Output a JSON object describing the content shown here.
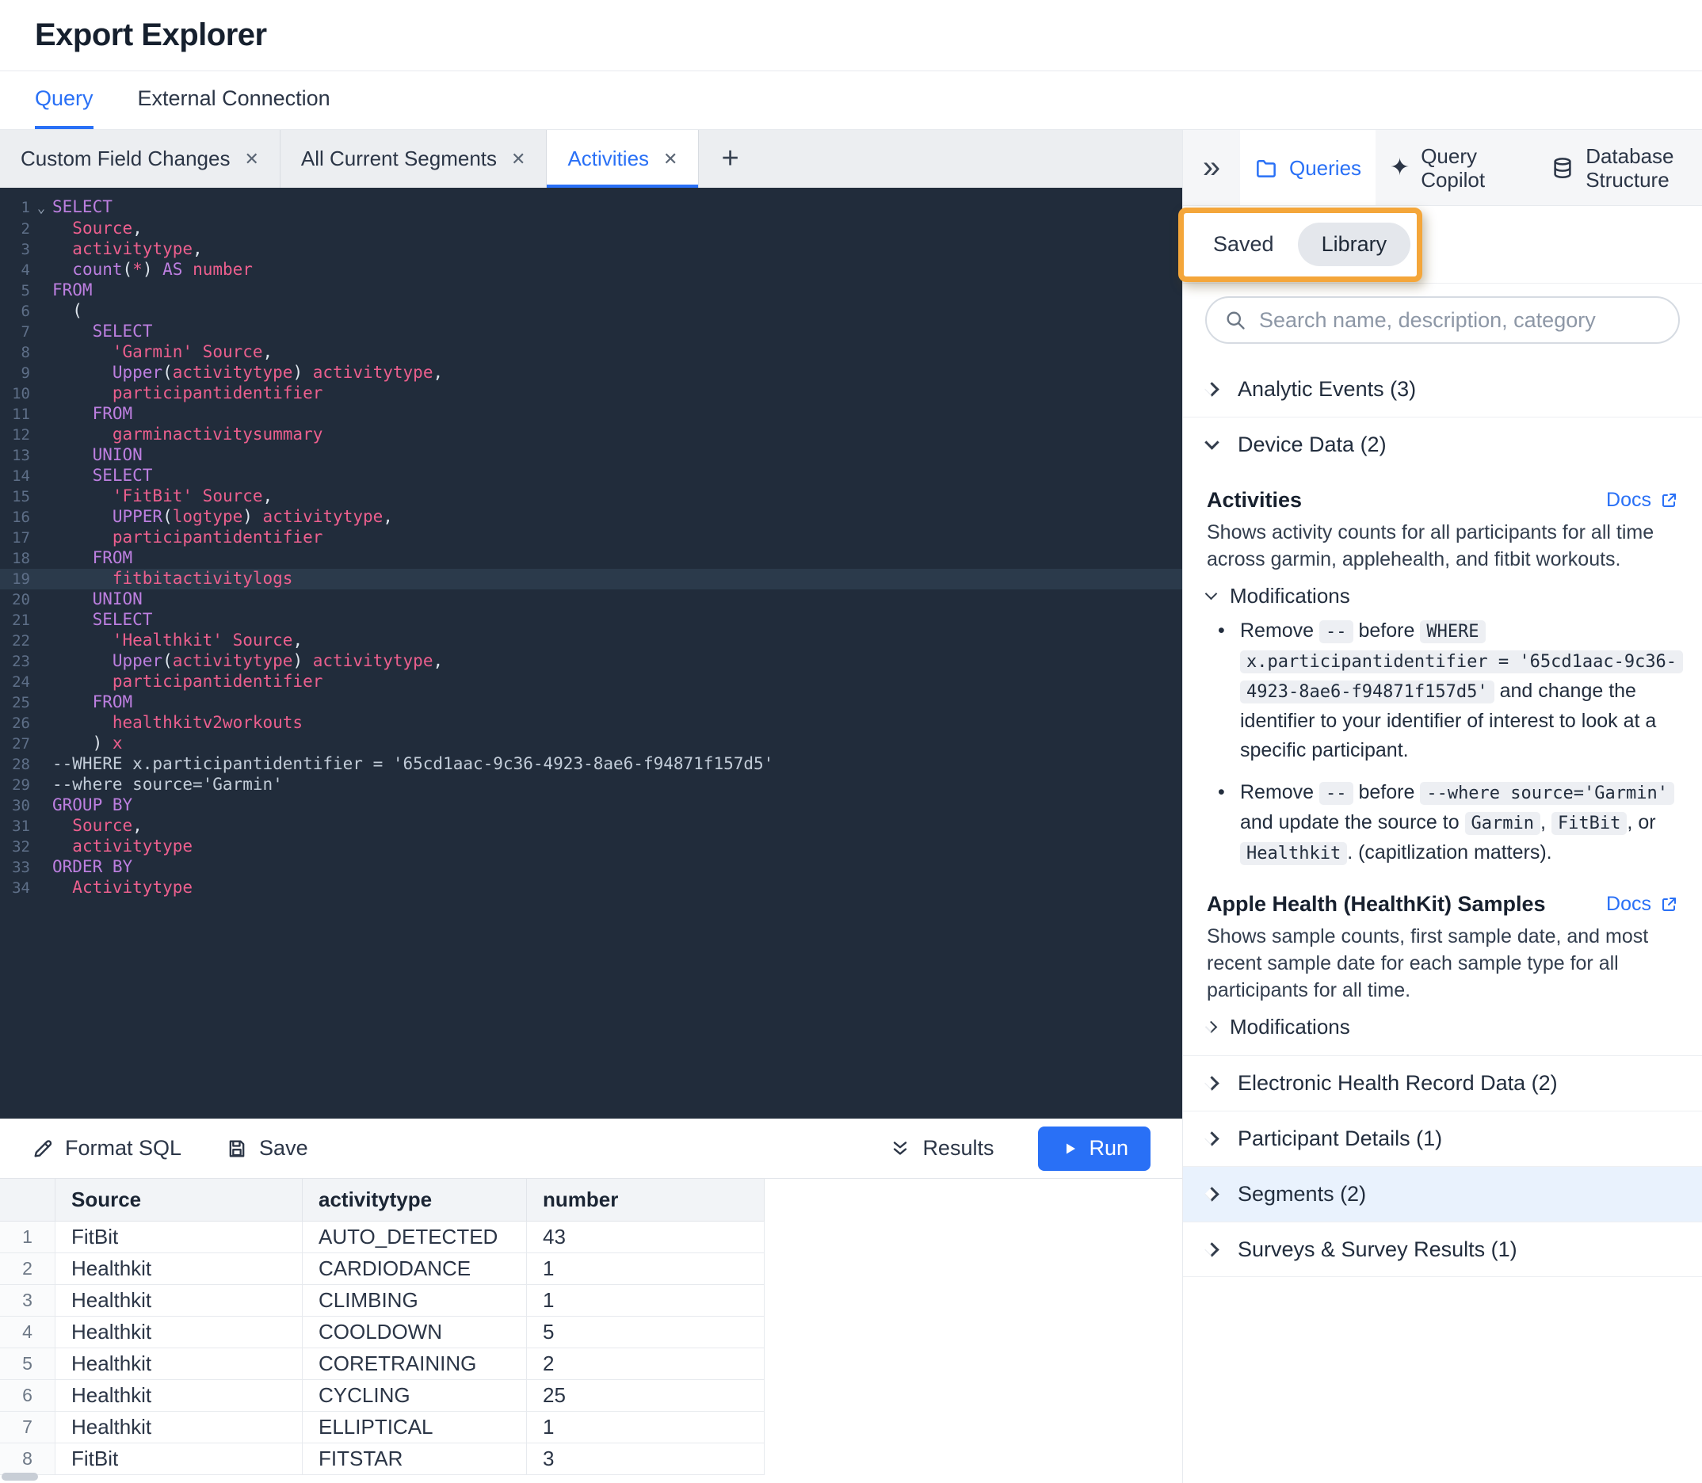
{
  "colors": {
    "accent_blue": "#2970f6",
    "annotation_orange": "#f4a63a",
    "editor_bg": "#212c3b",
    "editor_line_highlight": "#2b3a4b",
    "token_keyword": "#bd7fe0",
    "token_identifier": "#ec5f8e",
    "token_string": "#ec5f8e",
    "token_comment": "#c3cdd9",
    "token_plain": "#dfe6ee",
    "segments_highlight": "#e9f2fd"
  },
  "icons": {
    "collapse": "»",
    "sparkle": "✦",
    "close": "✕",
    "add_tab": "+",
    "fold": "⌄"
  },
  "header": {
    "title": "Export Explorer"
  },
  "nav": {
    "tabs": [
      {
        "label": "Query",
        "active": true
      },
      {
        "label": "External Connection",
        "active": false
      }
    ]
  },
  "editor_tabs": [
    {
      "label": "Custom Field Changes",
      "active": false
    },
    {
      "label": "All Current Segments",
      "active": false
    },
    {
      "label": "Activities",
      "active": true
    }
  ],
  "editor": {
    "lines": [
      {
        "tokens": [
          [
            "kw",
            "SELECT"
          ]
        ]
      },
      {
        "tokens": [
          [
            "pl",
            "  "
          ],
          [
            "id",
            "Source"
          ],
          [
            "pl",
            ","
          ]
        ]
      },
      {
        "tokens": [
          [
            "pl",
            "  "
          ],
          [
            "id",
            "activitytype"
          ],
          [
            "pl",
            ","
          ]
        ]
      },
      {
        "tokens": [
          [
            "pl",
            "  "
          ],
          [
            "fn",
            "count"
          ],
          [
            "pl",
            "("
          ],
          [
            "id",
            "*"
          ],
          [
            "pl",
            ") "
          ],
          [
            "kw",
            "AS"
          ],
          [
            "pl",
            " "
          ],
          [
            "id",
            "number"
          ]
        ]
      },
      {
        "tokens": [
          [
            "kw",
            "FROM"
          ]
        ]
      },
      {
        "tokens": [
          [
            "pl",
            "  ("
          ]
        ]
      },
      {
        "tokens": [
          [
            "pl",
            "    "
          ],
          [
            "kw",
            "SELECT"
          ]
        ]
      },
      {
        "tokens": [
          [
            "pl",
            "      "
          ],
          [
            "str",
            "'Garmin'"
          ],
          [
            "pl",
            " "
          ],
          [
            "id",
            "Source"
          ],
          [
            "pl",
            ","
          ]
        ]
      },
      {
        "tokens": [
          [
            "pl",
            "      "
          ],
          [
            "fn",
            "Upper"
          ],
          [
            "pl",
            "("
          ],
          [
            "id",
            "activitytype"
          ],
          [
            "pl",
            ") "
          ],
          [
            "id",
            "activitytype"
          ],
          [
            "pl",
            ","
          ]
        ]
      },
      {
        "tokens": [
          [
            "pl",
            "      "
          ],
          [
            "id",
            "participantidentifier"
          ]
        ]
      },
      {
        "tokens": [
          [
            "pl",
            "    "
          ],
          [
            "kw",
            "FROM"
          ]
        ]
      },
      {
        "tokens": [
          [
            "pl",
            "      "
          ],
          [
            "id",
            "garminactivitysummary"
          ]
        ]
      },
      {
        "tokens": [
          [
            "pl",
            "    "
          ],
          [
            "kw",
            "UNION"
          ]
        ]
      },
      {
        "tokens": [
          [
            "pl",
            "    "
          ],
          [
            "kw",
            "SELECT"
          ]
        ]
      },
      {
        "tokens": [
          [
            "pl",
            "      "
          ],
          [
            "str",
            "'FitBit'"
          ],
          [
            "pl",
            " "
          ],
          [
            "id",
            "Source"
          ],
          [
            "pl",
            ","
          ]
        ]
      },
      {
        "tokens": [
          [
            "pl",
            "      "
          ],
          [
            "fn",
            "UPPER"
          ],
          [
            "pl",
            "("
          ],
          [
            "id",
            "logtype"
          ],
          [
            "pl",
            ") "
          ],
          [
            "id",
            "activitytype"
          ],
          [
            "pl",
            ","
          ]
        ]
      },
      {
        "tokens": [
          [
            "pl",
            "      "
          ],
          [
            "id",
            "participantidentifier"
          ]
        ]
      },
      {
        "tokens": [
          [
            "pl",
            "    "
          ],
          [
            "kw",
            "FROM"
          ]
        ]
      },
      {
        "hl": true,
        "tokens": [
          [
            "pl",
            "      "
          ],
          [
            "id",
            "fitbitactivitylogs"
          ]
        ]
      },
      {
        "tokens": [
          [
            "pl",
            "    "
          ],
          [
            "kw",
            "UNION"
          ]
        ]
      },
      {
        "tokens": [
          [
            "pl",
            "    "
          ],
          [
            "kw",
            "SELECT"
          ]
        ]
      },
      {
        "tokens": [
          [
            "pl",
            "      "
          ],
          [
            "str",
            "'Healthkit'"
          ],
          [
            "pl",
            " "
          ],
          [
            "id",
            "Source"
          ],
          [
            "pl",
            ","
          ]
        ]
      },
      {
        "tokens": [
          [
            "pl",
            "      "
          ],
          [
            "fn",
            "Upper"
          ],
          [
            "pl",
            "("
          ],
          [
            "id",
            "activitytype"
          ],
          [
            "pl",
            ") "
          ],
          [
            "id",
            "activitytype"
          ],
          [
            "pl",
            ","
          ]
        ]
      },
      {
        "tokens": [
          [
            "pl",
            "      "
          ],
          [
            "id",
            "participantidentifier"
          ]
        ]
      },
      {
        "tokens": [
          [
            "pl",
            "    "
          ],
          [
            "kw",
            "FROM"
          ]
        ]
      },
      {
        "tokens": [
          [
            "pl",
            "      "
          ],
          [
            "id",
            "healthkitv2workouts"
          ]
        ]
      },
      {
        "tokens": [
          [
            "pl",
            "    ) "
          ],
          [
            "id",
            "x"
          ]
        ]
      },
      {
        "tokens": [
          [
            "cm",
            "--WHERE x.participantidentifier = '65cd1aac-9c36-4923-8ae6-f94871f157d5'"
          ]
        ]
      },
      {
        "tokens": [
          [
            "cm",
            "--where source='Garmin'"
          ]
        ]
      },
      {
        "tokens": [
          [
            "kw",
            "GROUP BY"
          ]
        ]
      },
      {
        "tokens": [
          [
            "pl",
            "  "
          ],
          [
            "id",
            "Source"
          ],
          [
            "pl",
            ","
          ]
        ]
      },
      {
        "tokens": [
          [
            "pl",
            "  "
          ],
          [
            "id",
            "activitytype"
          ]
        ]
      },
      {
        "tokens": [
          [
            "kw",
            "ORDER BY"
          ]
        ]
      },
      {
        "tokens": [
          [
            "pl",
            "  "
          ],
          [
            "id",
            "Activitytype"
          ]
        ]
      }
    ]
  },
  "toolbar": {
    "format_sql_label": "Format SQL",
    "save_label": "Save",
    "results_label": "Results",
    "run_label": "Run"
  },
  "results_table": {
    "columns": [
      "Source",
      "activitytype",
      "number"
    ],
    "rows": [
      [
        "FitBit",
        "AUTO_DETECTED",
        "43"
      ],
      [
        "Healthkit",
        "CARDIODANCE",
        "1"
      ],
      [
        "Healthkit",
        "CLIMBING",
        "1"
      ],
      [
        "Healthkit",
        "COOLDOWN",
        "5"
      ],
      [
        "Healthkit",
        "CORETRAINING",
        "2"
      ],
      [
        "Healthkit",
        "CYCLING",
        "25"
      ],
      [
        "Healthkit",
        "ELLIPTICAL",
        "1"
      ],
      [
        "FitBit",
        "FITSTAR",
        "3"
      ]
    ]
  },
  "sidebar": {
    "tabs": [
      {
        "label": "Queries",
        "active": true
      },
      {
        "label": "Query Copilot",
        "active": false
      },
      {
        "label": "Database Structure",
        "active": false
      }
    ],
    "toggle": {
      "saved_label": "Saved",
      "library_label": "Library",
      "selected": "Library"
    },
    "search": {
      "placeholder": "Search name, description, category"
    },
    "sections": {
      "analytic_events": {
        "label": "Analytic Events (3)",
        "expanded": false
      },
      "device_data": {
        "label": "Device Data (2)",
        "expanded": true
      },
      "ehr": {
        "label": "Electronic Health Record Data (2)",
        "expanded": false
      },
      "participant_details": {
        "label": "Participant Details (1)",
        "expanded": false
      },
      "segments": {
        "label": "Segments (2)",
        "expanded": false,
        "highlighted": true
      },
      "surveys": {
        "label": "Surveys & Survey Results (1)",
        "expanded": false
      }
    },
    "device_data_items": {
      "activities": {
        "title": "Activities",
        "docs_label": "Docs",
        "description": "Shows activity counts for all participants for all time across garmin, applehealth, and fitbit workouts.",
        "modifications_label": "Modifications",
        "modifications_expanded": true,
        "bullets": [
          [
            [
              "text",
              "Remove "
            ],
            [
              "code",
              "--"
            ],
            [
              "text",
              " before "
            ],
            [
              "code",
              "WHERE x.participantidentifier = '65cd1aac-9c36-4923-8ae6-f94871f157d5'"
            ],
            [
              "text",
              " and change the identifier to your identifier of interest to look at a specific participant."
            ]
          ],
          [
            [
              "text",
              "Remove "
            ],
            [
              "code",
              "--"
            ],
            [
              "text",
              " before "
            ],
            [
              "code",
              "--where source='Garmin'"
            ],
            [
              "text",
              " and update the source to "
            ],
            [
              "code",
              "Garmin"
            ],
            [
              "text",
              ", "
            ],
            [
              "code",
              "FitBit"
            ],
            [
              "text",
              ", or "
            ],
            [
              "code",
              "Healthkit"
            ],
            [
              "text",
              ". (capitlization matters)."
            ]
          ]
        ]
      },
      "apple_health": {
        "title": "Apple Health (HealthKit) Samples",
        "docs_label": "Docs",
        "description": "Shows sample counts, first sample date, and most recent sample date for each sample type for all participants for all time.",
        "modifications_label": "Modifications",
        "modifications_expanded": false
      }
    }
  }
}
